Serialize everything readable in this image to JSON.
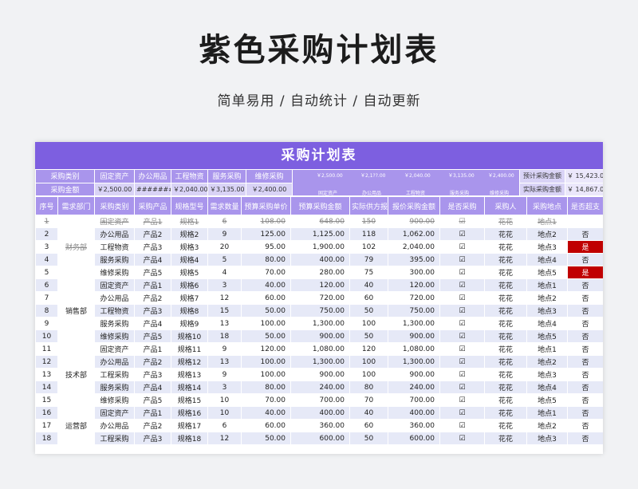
{
  "page": {
    "title": "紫色采购计划表",
    "subtitle": "简单易用 / 自动统计 / 自动更新"
  },
  "sheet": {
    "banner": "采购计划表",
    "summary": {
      "row1_label": "采购类别",
      "row2_label": "采购金额",
      "categories": [
        "固定资产",
        "办公用品",
        "工程物资",
        "服务采购",
        "维修采购"
      ],
      "amounts": [
        "￥2,500.00",
        "########",
        "￥2,040.00",
        "￥3,135.00",
        "￥2,400.00"
      ],
      "mini_chart": {
        "values": [
          "￥2,500.00",
          "￥2,1??.00",
          "￥2,040.00",
          "￥3,135.00",
          "￥2,400.00"
        ],
        "labels": [
          "固定资产",
          "办公用品",
          "工程物资",
          "服务采购",
          "维修采购"
        ]
      },
      "est_label": "预计采购金额",
      "est_value": "￥    15,423.00",
      "act_label": "实际采购金额",
      "act_value": "￥    14,867.00"
    },
    "columns": [
      "序号",
      "需求部门",
      "采购类别",
      "采购产品",
      "规格型号",
      "需求数量",
      "预算采购单价",
      "预算采购金额",
      "实际供方报价",
      "报价采购金额",
      "是否采购",
      "采购人",
      "采购地点",
      "是否超支"
    ],
    "departments": [
      "财务部",
      "销售部",
      "技术部",
      "运营部"
    ],
    "rows": [
      [
        "1",
        "固定资产",
        "产品1",
        "规格1",
        "6",
        "108.00",
        "648.00",
        "150",
        "900.00",
        "☑",
        "花花",
        "地点1",
        ""
      ],
      [
        "2",
        "办公用品",
        "产品2",
        "规格2",
        "9",
        "125.00",
        "1,125.00",
        "118",
        "1,062.00",
        "☑",
        "花花",
        "地点2",
        "否"
      ],
      [
        "3",
        "工程物资",
        "产品3",
        "规格3",
        "20",
        "95.00",
        "1,900.00",
        "102",
        "2,040.00",
        "☑",
        "花花",
        "地点3",
        "是"
      ],
      [
        "4",
        "服务采购",
        "产品4",
        "规格4",
        "5",
        "80.00",
        "400.00",
        "79",
        "395.00",
        "☑",
        "花花",
        "地点4",
        "否"
      ],
      [
        "5",
        "维修采购",
        "产品5",
        "规格5",
        "4",
        "70.00",
        "280.00",
        "75",
        "300.00",
        "☑",
        "花花",
        "地点5",
        "是"
      ],
      [
        "6",
        "固定资产",
        "产品1",
        "规格6",
        "3",
        "40.00",
        "120.00",
        "40",
        "120.00",
        "☑",
        "花花",
        "地点1",
        "否"
      ],
      [
        "7",
        "办公用品",
        "产品2",
        "规格7",
        "12",
        "60.00",
        "720.00",
        "60",
        "720.00",
        "☑",
        "花花",
        "地点2",
        "否"
      ],
      [
        "8",
        "工程物资",
        "产品3",
        "规格8",
        "15",
        "50.00",
        "750.00",
        "50",
        "750.00",
        "☑",
        "花花",
        "地点3",
        "否"
      ],
      [
        "9",
        "服务采购",
        "产品4",
        "规格9",
        "13",
        "100.00",
        "1,300.00",
        "100",
        "1,300.00",
        "☑",
        "花花",
        "地点4",
        "否"
      ],
      [
        "10",
        "维修采购",
        "产品5",
        "规格10",
        "18",
        "50.00",
        "900.00",
        "50",
        "900.00",
        "☑",
        "花花",
        "地点5",
        "否"
      ],
      [
        "11",
        "固定资产",
        "产品1",
        "规格11",
        "9",
        "120.00",
        "1,080.00",
        "120",
        "1,080.00",
        "☑",
        "花花",
        "地点1",
        "否"
      ],
      [
        "12",
        "办公用品",
        "产品2",
        "规格12",
        "13",
        "100.00",
        "1,300.00",
        "100",
        "1,300.00",
        "☑",
        "花花",
        "地点2",
        "否"
      ],
      [
        "13",
        "工程采购",
        "产品3",
        "规格13",
        "9",
        "100.00",
        "900.00",
        "100",
        "900.00",
        "☑",
        "花花",
        "地点3",
        "否"
      ],
      [
        "14",
        "服务采购",
        "产品4",
        "规格14",
        "3",
        "80.00",
        "240.00",
        "80",
        "240.00",
        "☑",
        "花花",
        "地点4",
        "否"
      ],
      [
        "15",
        "维修采购",
        "产品5",
        "规格15",
        "10",
        "70.00",
        "700.00",
        "70",
        "700.00",
        "☑",
        "花花",
        "地点5",
        "否"
      ],
      [
        "16",
        "固定资产",
        "产品1",
        "规格16",
        "10",
        "40.00",
        "400.00",
        "40",
        "400.00",
        "☑",
        "花花",
        "地点1",
        "否"
      ],
      [
        "17",
        "办公用品",
        "产品2",
        "规格17",
        "6",
        "60.00",
        "360.00",
        "60",
        "360.00",
        "☑",
        "花花",
        "地点2",
        "否"
      ],
      [
        "18",
        "工程采购",
        "产品3",
        "规格18",
        "12",
        "50.00",
        "600.00",
        "50",
        "600.00",
        "☑",
        "花花",
        "地点3",
        "否"
      ]
    ],
    "colors": {
      "banner": "#7d5fe0",
      "header": "#a995ec",
      "stripe": "#e6e9f7",
      "overspend": "#c00000"
    }
  }
}
